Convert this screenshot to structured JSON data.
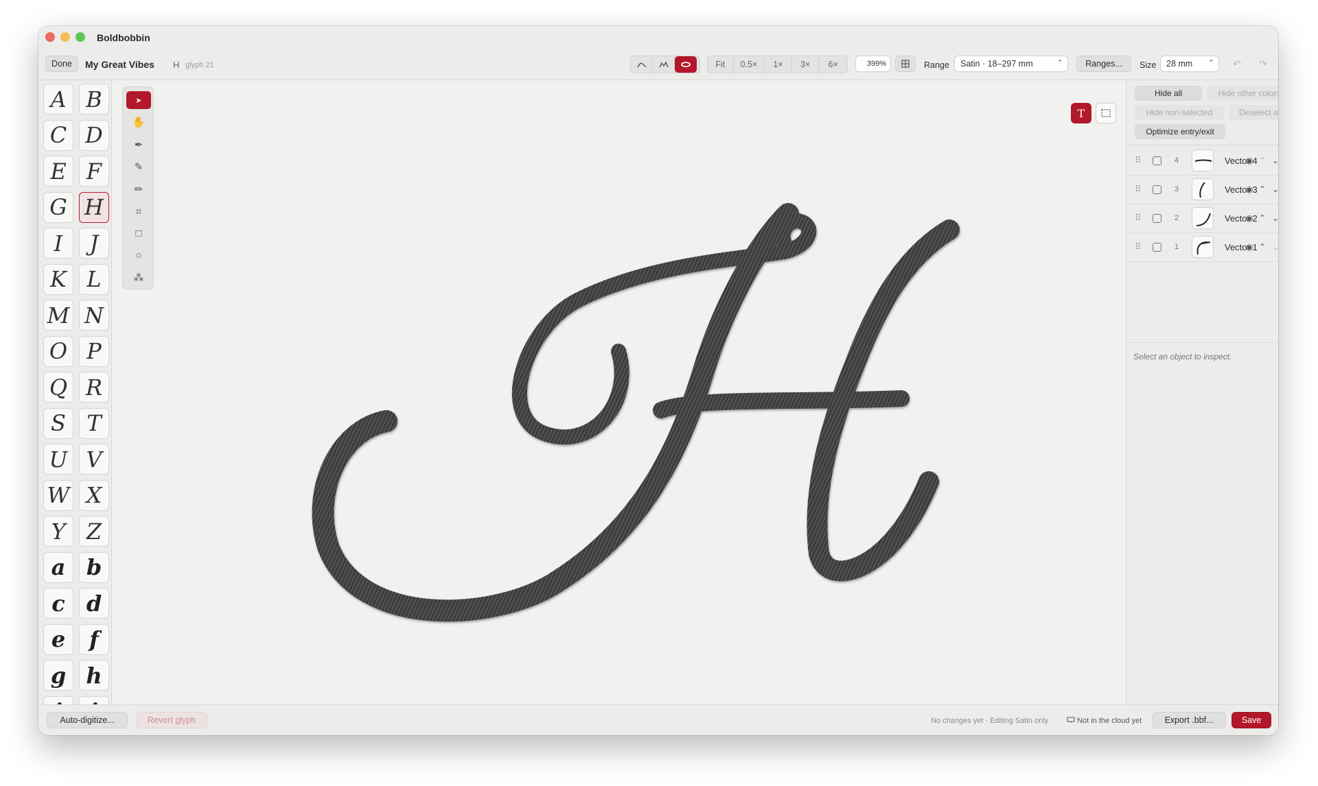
{
  "app": {
    "title": "Boldbobbin"
  },
  "toolbar": {
    "done_label": "Done",
    "font_name": "My Great Vibes",
    "glyph_char": "H",
    "glyph_index": "glyph 21",
    "view_modes": [
      "path-icon",
      "zigzag-icon",
      "satin-icon"
    ],
    "zoom_buttons": [
      "Fit",
      "0.5×",
      "1×",
      "3×",
      "6×"
    ],
    "zoom_value": "399%",
    "range_label": "Range",
    "range_value": "Satin · 18–297 mm",
    "ranges_button": "Ranges...",
    "size_label": "Size",
    "size_value": "28 mm",
    "accent_color": "#b3172a"
  },
  "glyphs": [
    {
      "char": "A"
    },
    {
      "char": "B"
    },
    {
      "char": "C"
    },
    {
      "char": "D"
    },
    {
      "char": "E"
    },
    {
      "char": "F"
    },
    {
      "char": "G"
    },
    {
      "char": "H",
      "selected": true
    },
    {
      "char": "I"
    },
    {
      "char": "J"
    },
    {
      "char": "K"
    },
    {
      "char": "L"
    },
    {
      "char": "M"
    },
    {
      "char": "N"
    },
    {
      "char": "O"
    },
    {
      "char": "P"
    },
    {
      "char": "Q"
    },
    {
      "char": "R"
    },
    {
      "char": "S"
    },
    {
      "char": "T"
    },
    {
      "char": "U"
    },
    {
      "char": "V"
    },
    {
      "char": "W"
    },
    {
      "char": "X"
    },
    {
      "char": "Y"
    },
    {
      "char": "Z"
    },
    {
      "char": "a",
      "bold": true
    },
    {
      "char": "b",
      "bold": true
    },
    {
      "char": "c",
      "bold": true
    },
    {
      "char": "d",
      "bold": true
    },
    {
      "char": "e",
      "bold": true
    },
    {
      "char": "f",
      "bold": true
    },
    {
      "char": "g",
      "bold": true
    },
    {
      "char": "h",
      "bold": true
    },
    {
      "char": "i",
      "bold": true
    },
    {
      "char": "i",
      "bold": true
    }
  ],
  "tools": [
    "select-arrow-icon",
    "hand-icon",
    "pen-icon",
    "bezier-icon",
    "pencil-icon",
    "node-icon",
    "rectangle-icon",
    "ellipse-icon",
    "shapes-icon"
  ],
  "canvas": {
    "text_tool_icon": "T",
    "frame_icon": "frame-icon"
  },
  "right_panel": {
    "hide_all": "Hide all",
    "hide_other_colors": "Hide other colors",
    "hide_non_selected": "Hide non-selected",
    "deselect_all": "Deselect all",
    "optimize": "Optimize entry/exit",
    "layers": [
      {
        "index": "4",
        "name": "Vector 4"
      },
      {
        "index": "3",
        "name": "Vector 3"
      },
      {
        "index": "2",
        "name": "Vector 2"
      },
      {
        "index": "1",
        "name": "Vector 1"
      }
    ],
    "inspect_hint": "Select an object to inspect."
  },
  "bottom": {
    "auto_digitize": "Auto-digitize...",
    "revert": "Revert glyph",
    "status": "No changes yet · Editing Satin only",
    "cloud": "Not in the cloud yet",
    "export": "Export .bbf...",
    "save": "Save"
  }
}
